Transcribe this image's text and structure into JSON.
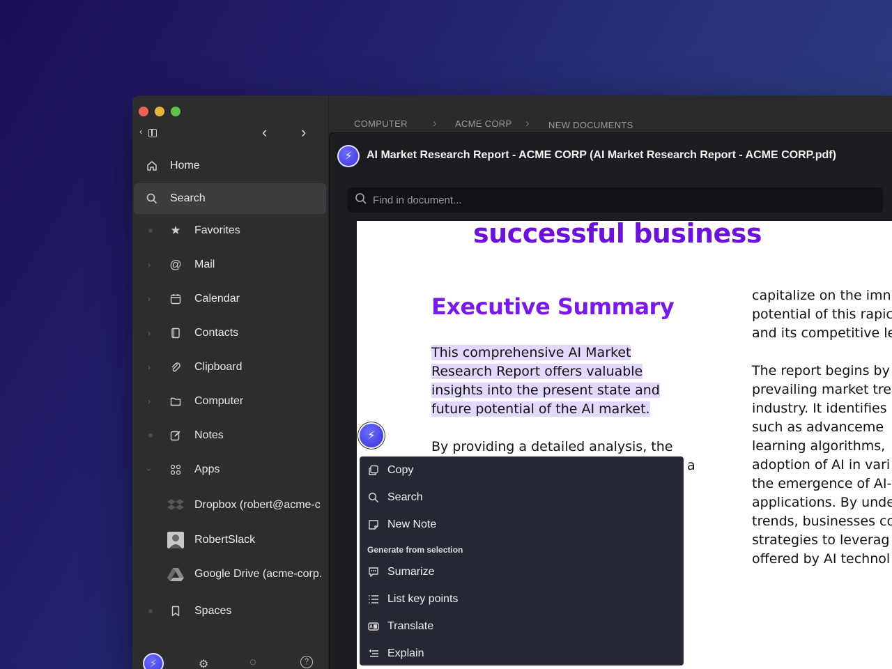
{
  "sidebar": {
    "items": [
      {
        "label": "Home",
        "icon": "home-icon"
      },
      {
        "label": "Search",
        "icon": "search-icon"
      },
      {
        "label": "Favorites",
        "icon": "star-icon"
      },
      {
        "label": "Mail",
        "icon": "at-icon"
      },
      {
        "label": "Calendar",
        "icon": "calendar-icon"
      },
      {
        "label": "Contacts",
        "icon": "contacts-icon"
      },
      {
        "label": "Clipboard",
        "icon": "paperclip-icon"
      },
      {
        "label": "Computer",
        "icon": "folder-icon"
      },
      {
        "label": "Notes",
        "icon": "edit-icon"
      },
      {
        "label": "Apps",
        "icon": "apps-icon"
      },
      {
        "label": "Dropbox (robert@acme-c",
        "icon": "dropbox-icon"
      },
      {
        "label": "RobertSlack",
        "icon": "avatar"
      },
      {
        "label": "Google Drive (acme-corp.",
        "icon": "google-drive-icon"
      },
      {
        "label": "Spaces",
        "icon": "bookmark-icon"
      }
    ]
  },
  "breadcrumb": {
    "items": [
      "COMPUTER",
      "ACME CORP",
      "NEW DOCUMENTS"
    ]
  },
  "document": {
    "title": "AI Market Research Report - ACME CORP (AI Market Research Report - ACME CORP.pdf)",
    "find_placeholder": "Find in document...",
    "headline": "successful business",
    "section_title": "Executive Summary",
    "para1_lines": [
      "This comprehensive AI Market",
      "Research Report offers valuable",
      "insights into the present state and",
      "future potential of the AI market."
    ],
    "para2_line1": "By providing a detailed analysis, the",
    "para2_line2_tail": "a",
    "col2_block1": "capitalize on the imn\npotential of this rapic\nand its competitive le",
    "col2_block2": "The report begins by\nprevailing market tre\nindustry. It identifies k\nsuch as advanceme\nlearning algorithms,\nadoption of AI in vari\nthe emergence of AI-\napplications. By unde\ntrends, businesses co\nstrategies to leverag\noffered by AI technol"
  },
  "context_menu": {
    "items": [
      {
        "label": "Copy",
        "icon": "copy-icon"
      },
      {
        "label": "Search",
        "icon": "search-icon"
      },
      {
        "label": "New Note",
        "icon": "note-icon"
      }
    ],
    "section_label": "Generate from selection",
    "generate_items": [
      {
        "label": "Sumarize",
        "icon": "summarize-icon"
      },
      {
        "label": "List key points",
        "icon": "list-icon"
      },
      {
        "label": "Translate",
        "icon": "translate-icon"
      },
      {
        "label": "Explain",
        "icon": "explain-icon"
      }
    ]
  },
  "colors": {
    "accent_purple": "#6a12d9",
    "highlight": "#e3d7fb",
    "badge_blue": "#3532d8"
  }
}
